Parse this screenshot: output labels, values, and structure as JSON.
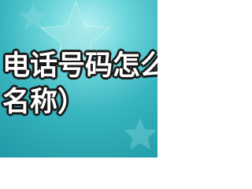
{
  "headline": {
    "line1": "电话号码怎么",
    "line2": "名称）"
  },
  "decorations": {
    "background_color": "#39b5bf",
    "highlight_color": "#b8f2f3",
    "star_color": "#9fe3e6",
    "text_color": "#ffffff",
    "outline_color": "#1a1a1a"
  }
}
